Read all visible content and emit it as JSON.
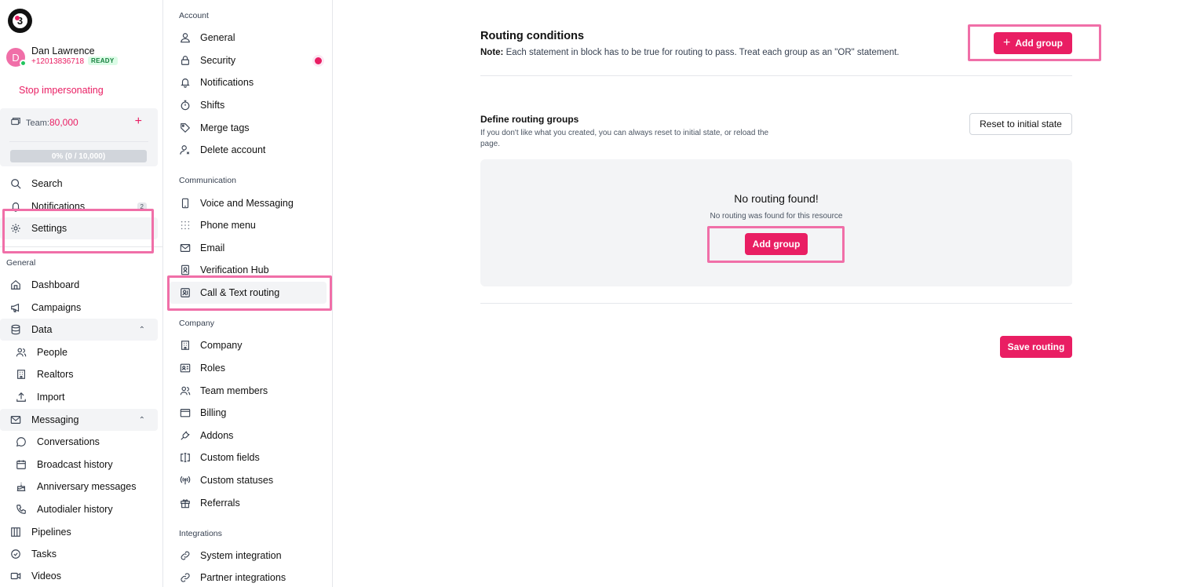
{
  "user": {
    "initial": "D",
    "name": "Dan Lawrence",
    "phone": "+12013836718",
    "status": "READY"
  },
  "stop_impersonating": "Stop impersonating",
  "team": {
    "label": "Team:",
    "value": "80,000",
    "add_icon": "plus-icon",
    "progress_text": "0% (0 / 10,000)",
    "progress_fraction": 0
  },
  "sidebar": {
    "top_items": [
      {
        "label": "Search",
        "icon": "search-icon"
      },
      {
        "label": "Notifications",
        "icon": "bell-icon",
        "count": "2"
      },
      {
        "label": "Settings",
        "icon": "gear-icon"
      }
    ],
    "general_label": "General",
    "general_items": [
      {
        "label": "Dashboard",
        "icon": "home-icon"
      },
      {
        "label": "Campaigns",
        "icon": "megaphone-icon"
      },
      {
        "label": "Data",
        "icon": "database-icon"
      },
      {
        "label": "People",
        "icon": "people-icon"
      },
      {
        "label": "Realtors",
        "icon": "building-icon"
      },
      {
        "label": "Import",
        "icon": "upload-icon"
      },
      {
        "label": "Messaging",
        "icon": "mail-icon"
      },
      {
        "label": "Conversations",
        "icon": "chat-icon"
      },
      {
        "label": "Broadcast history",
        "icon": "calendar-icon"
      },
      {
        "label": "Anniversary messages",
        "icon": "cake-icon"
      },
      {
        "label": "Autodialer history",
        "icon": "phone-icon"
      },
      {
        "label": "Pipelines",
        "icon": "columns-icon"
      },
      {
        "label": "Tasks",
        "icon": "check-circle-icon"
      },
      {
        "label": "Videos",
        "icon": "video-icon"
      }
    ]
  },
  "settings_nav": {
    "account_label": "Account",
    "account_items": [
      {
        "label": "General",
        "icon": "user-icon"
      },
      {
        "label": "Security",
        "icon": "lock-icon"
      },
      {
        "label": "Notifications",
        "icon": "bell-icon"
      },
      {
        "label": "Shifts",
        "icon": "stopwatch-icon"
      },
      {
        "label": "Merge tags",
        "icon": "tag-icon"
      },
      {
        "label": "Delete account",
        "icon": "user-x-icon"
      }
    ],
    "communication_label": "Communication",
    "communication_items": [
      {
        "label": "Voice and Messaging",
        "icon": "mobile-icon"
      },
      {
        "label": "Phone menu",
        "icon": "dialpad-icon"
      },
      {
        "label": "Email",
        "icon": "mail-icon"
      },
      {
        "label": "Verification Hub",
        "icon": "id-badge-icon"
      },
      {
        "label": "Call & Text routing",
        "icon": "routing-icon"
      }
    ],
    "company_label": "Company",
    "company_items": [
      {
        "label": "Company",
        "icon": "building-icon"
      },
      {
        "label": "Roles",
        "icon": "id-card-icon"
      },
      {
        "label": "Team members",
        "icon": "people-icon"
      },
      {
        "label": "Billing",
        "icon": "wallet-icon"
      },
      {
        "label": "Addons",
        "icon": "plug-icon"
      },
      {
        "label": "Custom fields",
        "icon": "field-icon"
      },
      {
        "label": "Custom statuses",
        "icon": "broadcast-icon"
      },
      {
        "label": "Referrals",
        "icon": "gift-icon"
      }
    ],
    "integrations_label": "Integrations",
    "integrations_items": [
      {
        "label": "System integration",
        "icon": "link-icon"
      },
      {
        "label": "Partner integrations",
        "icon": "chain-icon"
      }
    ]
  },
  "routing": {
    "title": "Routing conditions",
    "note_label": "Note:",
    "note_text": " Each statement in block has to be true for routing to pass. Treat each group as an \"OR\" statement.",
    "add_group_label": "Add group",
    "define_title": "Define routing groups",
    "define_desc": "If you don't like what you created, you can always reset to initial state, or reload the page.",
    "reset_label": "Reset to initial state",
    "empty_title": "No routing found!",
    "empty_sub": "No routing was found for this resource",
    "empty_add_label": "Add group",
    "save_label": "Save routing"
  },
  "colors": {
    "accent": "#e91e63",
    "highlight": "#f06fa8",
    "ready": "#15803d"
  }
}
